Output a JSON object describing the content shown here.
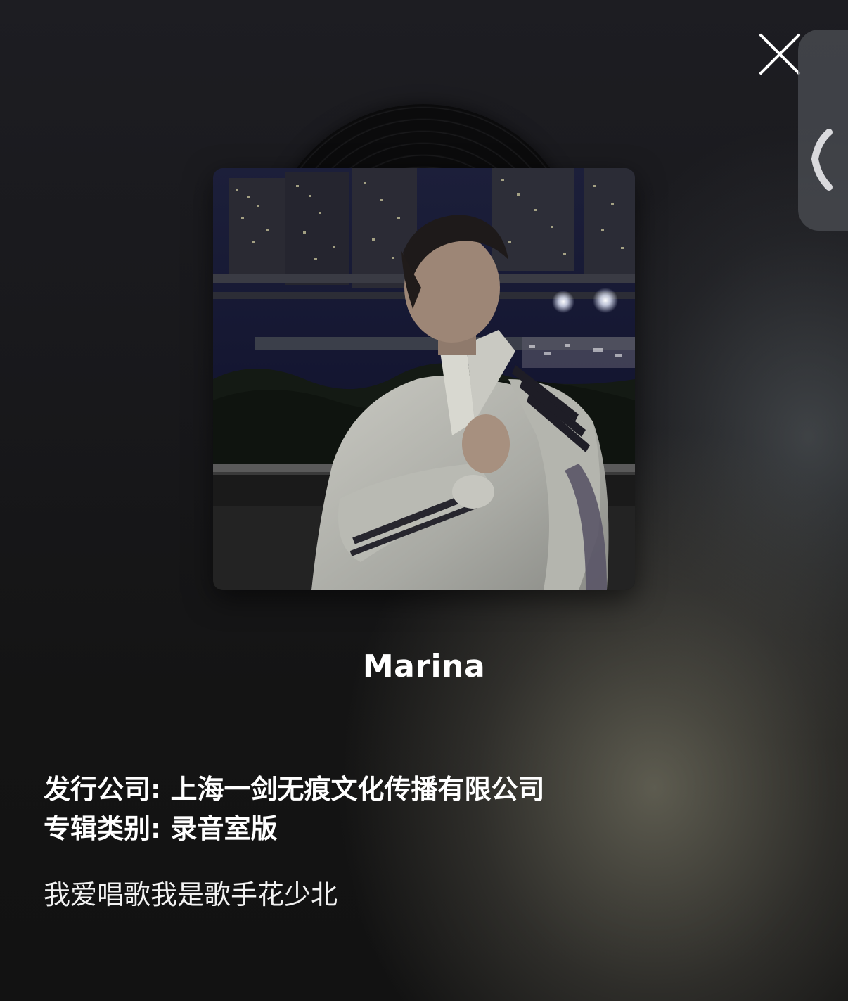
{
  "album": {
    "title": "Marina",
    "publisher_label": "发行公司:",
    "publisher_value": "上海一剑无痕文化传播有限公司",
    "type_label": "专辑类别:",
    "type_value": "录音室版",
    "description": "我爱唱歌我是歌手花少北"
  },
  "icons": {
    "close": "close-icon",
    "side_tab": "chevron-left-icon",
    "cover": "album-cover-photo"
  },
  "colors": {
    "text": "#ffffff",
    "divider": "#3a3a3a",
    "side_tab": "#4e5056"
  }
}
